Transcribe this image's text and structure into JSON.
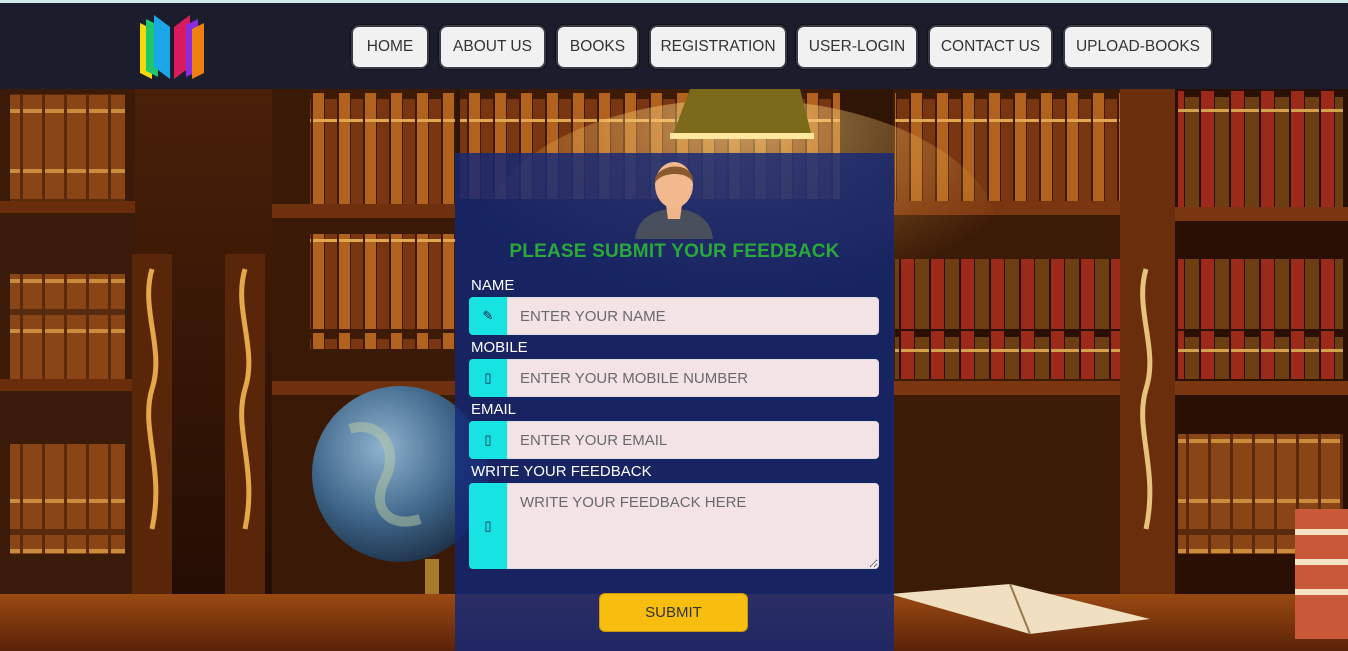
{
  "nav": {
    "items": [
      {
        "label": "HOME"
      },
      {
        "label": "ABOUT US"
      },
      {
        "label": "BOOKS"
      },
      {
        "label": "REGISTRATION"
      },
      {
        "label": "USER-LOGIN"
      },
      {
        "label": "CONTACT US"
      },
      {
        "label": "UPLOAD-BOOKS"
      }
    ]
  },
  "form": {
    "title": "PLEASE SUBMIT YOUR FEEDBACK",
    "name": {
      "label": "NAME",
      "placeholder": "ENTER YOUR NAME",
      "icon": "pencil-icon"
    },
    "mobile": {
      "label": "MOBILE",
      "placeholder": "ENTER YOUR MOBILE NUMBER",
      "icon": "phone-icon"
    },
    "email": {
      "label": "EMAIL",
      "placeholder": "ENTER YOUR EMAIL",
      "icon": "envelope-icon"
    },
    "feedback": {
      "label": "WRITE YOUR FEEDBACK",
      "placeholder": "WRITE YOUR FEEDBACK HERE",
      "icon": "comment-icon"
    },
    "submit_label": "SUBMIT"
  },
  "colors": {
    "navbar_bg": "#1b1c2c",
    "form_title": "#2aa83a",
    "icon_box": "#17e3e3",
    "submit_bg": "#f7be10"
  }
}
